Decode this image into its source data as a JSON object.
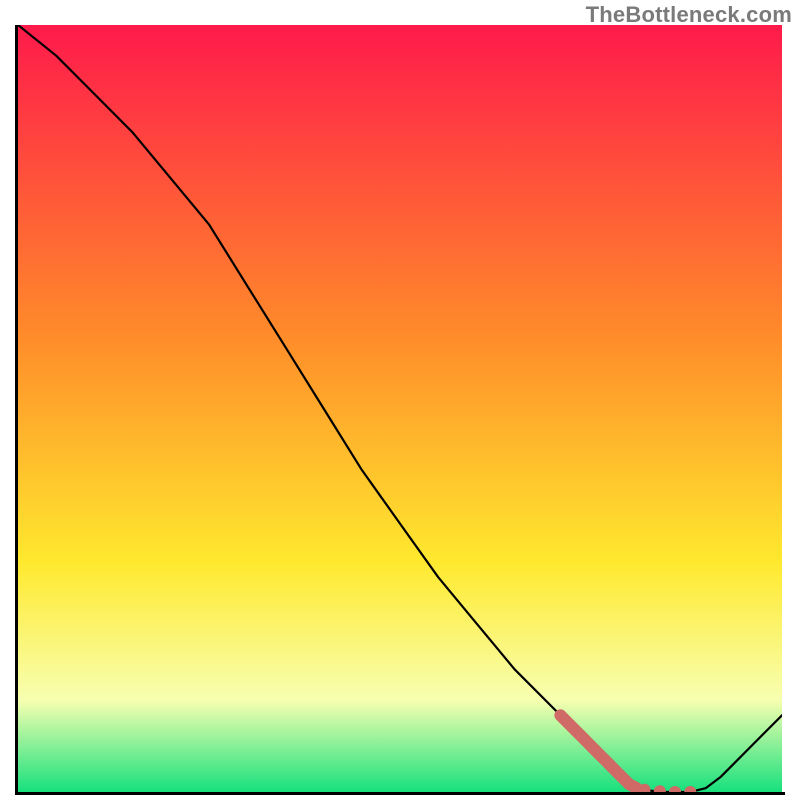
{
  "attribution": "TheBottleneck.com",
  "colors": {
    "gradient_top": "#ff1a4b",
    "gradient_mid1": "#ff8a2a",
    "gradient_mid2": "#ffe92e",
    "gradient_low": "#f7ffb0",
    "gradient_bottom": "#17e07d",
    "curve": "#000000",
    "marker": "#cf6a66"
  },
  "chart_data": {
    "type": "line",
    "title": "",
    "xlabel": "",
    "ylabel": "",
    "xlim": [
      0,
      100
    ],
    "ylim": [
      0,
      100
    ],
    "grid": false,
    "series": [
      {
        "name": "bottleneck-curve",
        "x": [
          0,
          5,
          10,
          15,
          20,
          25,
          30,
          35,
          40,
          45,
          50,
          55,
          60,
          65,
          70,
          75,
          78,
          80,
          82,
          84,
          86,
          88,
          90,
          92,
          94,
          96,
          98,
          100
        ],
        "y": [
          100,
          96,
          91,
          86,
          80,
          74,
          66,
          58,
          50,
          42,
          35,
          28,
          22,
          16,
          11,
          6,
          3,
          1,
          0.3,
          0,
          0,
          0,
          0.5,
          2,
          4,
          6,
          8,
          10
        ]
      }
    ],
    "markers": {
      "name": "highlight-segment",
      "color": "#cf6a66",
      "x": [
        71,
        72,
        73,
        74,
        75,
        76,
        77,
        78,
        79,
        80,
        81,
        82,
        84,
        86,
        88
      ],
      "y": [
        10,
        9,
        8,
        7,
        6,
        5,
        4,
        3,
        2,
        1,
        0.5,
        0.3,
        0.1,
        0,
        0
      ]
    },
    "gradient_stops": [
      {
        "pos": 0.0,
        "color": "#ff1a4b"
      },
      {
        "pos": 0.4,
        "color": "#ff8a2a"
      },
      {
        "pos": 0.7,
        "color": "#ffe92e"
      },
      {
        "pos": 0.88,
        "color": "#f7ffb0"
      },
      {
        "pos": 1.0,
        "color": "#17e07d"
      }
    ]
  }
}
